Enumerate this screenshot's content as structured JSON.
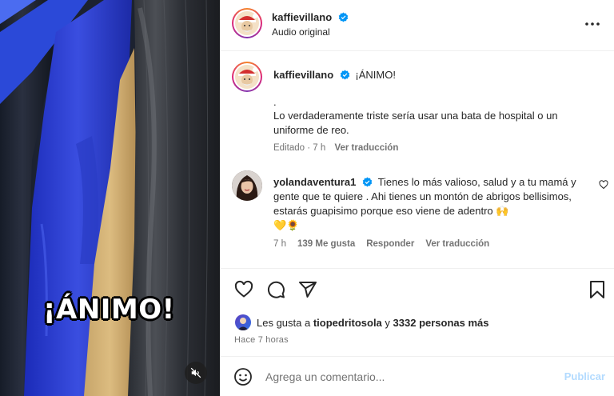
{
  "media": {
    "caption": "¡ÁNIMO!",
    "mute_icon": "speaker-muted-icon"
  },
  "header": {
    "username": "kaffievillano",
    "subtitle": "Audio original",
    "more_icon": "more-horizontal-icon"
  },
  "post": {
    "username": "kaffievillano",
    "headline": "¡ÁNIMO!",
    "dot": ".",
    "body": "Lo verdaderamente triste sería usar una bata de hospital o un uniforme de reo.",
    "edited": "Editado",
    "time": "7 h",
    "translate": "Ver traducción"
  },
  "comment": {
    "username": "yolandaventura1",
    "text": "Tienes lo más valioso, salud y a tu mamá y gente que te quiere . Ahi tienes un montón de abrigos bellisimos, estarás guapisimo porque eso viene de adentro 🙌",
    "emojis": "💛🌻",
    "time": "7 h",
    "likes": "139 Me gusta",
    "reply": "Responder",
    "translate": "Ver traducción"
  },
  "likes": {
    "prefix": "Les gusta a",
    "user": "tiopedritosola",
    "middle": "y",
    "others": "3332 personas más"
  },
  "time_ago": "Hace 7 horas",
  "composer": {
    "placeholder": "Agrega un comentario...",
    "publish": "Publicar"
  },
  "colors": {
    "verified": "#0095f6",
    "muted_text": "#737373",
    "publish_disabled": "#b3dbff"
  }
}
